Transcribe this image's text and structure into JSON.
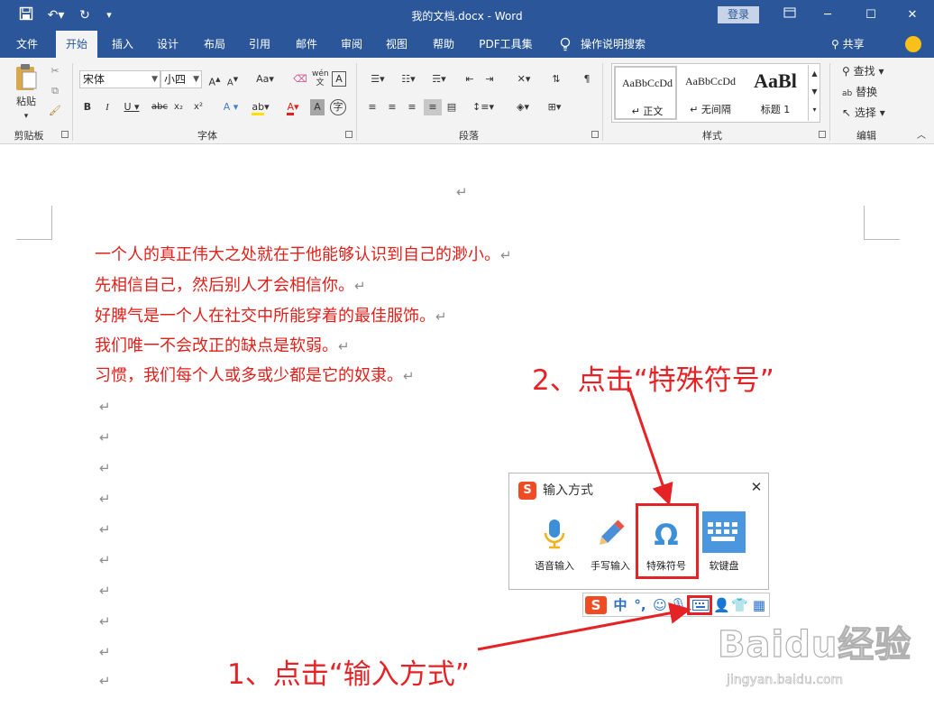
{
  "window": {
    "title": "我的文档.docx  -  Word",
    "login_label": "登录"
  },
  "ribbon_tabs": [
    "文件",
    "开始",
    "插入",
    "设计",
    "布局",
    "引用",
    "邮件",
    "审阅",
    "视图",
    "帮助",
    "PDF工具集",
    "操作说明搜索"
  ],
  "share_label": "共享",
  "ribbon": {
    "clipboard": {
      "paste_label": "粘贴",
      "group_label": "剪贴板"
    },
    "font": {
      "font_name": "宋体",
      "font_size": "小四",
      "group_label": "字体"
    },
    "paragraph": {
      "group_label": "段落"
    },
    "styles": {
      "items": [
        {
          "sample": "AaBbCcDd",
          "name": "↵ 正文"
        },
        {
          "sample": "AaBbCcDd",
          "name": "↵ 无间隔"
        },
        {
          "sample": "AaBl",
          "name": "标题 1"
        }
      ],
      "group_label": "样式"
    },
    "editing": {
      "find_label": "查找",
      "replace_label": "替换",
      "select_label": "选择",
      "group_label": "编辑"
    }
  },
  "document": {
    "lines": [
      "一个人的真正伟大之处就在于他能够认识到自己的渺小。",
      "先相信自己，然后别人才会相信你。",
      "好脾气是一个人在社交中所能穿着的最佳服饰。",
      "我们唯一不会改正的缺点是软弱。",
      "习惯，我们每个人或多或少都是它的奴隶。"
    ],
    "paragraph_mark": "↵",
    "text_color": "#e0201b"
  },
  "ime_panel": {
    "title": "输入方式",
    "logo": "S",
    "options": [
      {
        "icon": "microphone-icon",
        "label": "语音输入"
      },
      {
        "icon": "pen-icon",
        "label": "手写输入"
      },
      {
        "icon": "omega-icon",
        "label": "特殊符号"
      },
      {
        "icon": "keyboard-icon",
        "label": "软键盘"
      }
    ]
  },
  "ime_bar": {
    "logo": "S",
    "mode": "中"
  },
  "annotations": {
    "step1": "1、点击“输入方式”",
    "step2": "2、点击“特殊符号”",
    "color": "#e52326"
  },
  "watermark": {
    "logo_text": "Baidu经验",
    "url": "jingyan.baidu.com"
  }
}
